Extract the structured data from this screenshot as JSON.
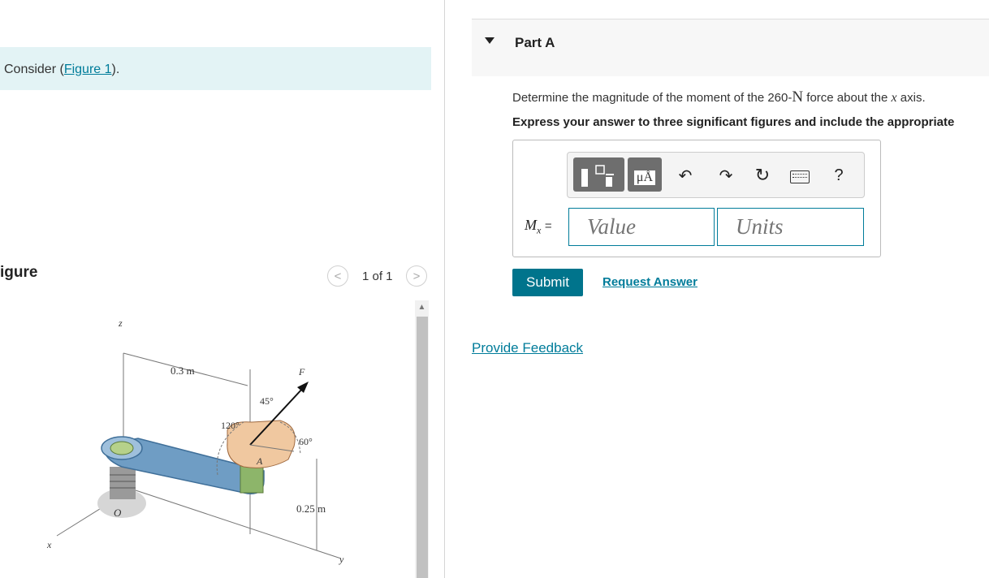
{
  "left_pane": {
    "consider_prefix": "Consider (",
    "figure_link": "Figure 1",
    "consider_suffix": ").",
    "figure_heading": "igure",
    "pager": {
      "prev": "<",
      "count": "1 of 1",
      "next": ">"
    }
  },
  "figure": {
    "z": "z",
    "x": "x",
    "y": "y",
    "O": "O",
    "A": "A",
    "F": "F",
    "dim_03": "0.3 m",
    "dim_025": "0.25 m",
    "angle_45": "45°",
    "angle_120": "120°",
    "angle_60": "60°"
  },
  "part": {
    "title": "Part A",
    "question_prefix": "Determine the magnitude of the moment of the 260-",
    "question_unit": "N",
    "question_mid": " force about the ",
    "question_var": "x",
    "question_suffix": " axis.",
    "instruction": "Express your answer to three significant figures and include the appropriate"
  },
  "toolbar": {
    "template_icon": "template-icon",
    "units_label": "μÅ",
    "undo": "↶",
    "redo": "↷",
    "reset": "↻",
    "keyboard": "keyboard-icon",
    "help": "?"
  },
  "answer": {
    "var": "M",
    "sub": "x",
    "eq": "=",
    "value_placeholder": "Value",
    "units_placeholder": "Units"
  },
  "actions": {
    "submit": "Submit",
    "request_answer": "Request Answer",
    "feedback": "Provide Feedback"
  },
  "colors": {
    "accent": "#007c9a",
    "submit": "#00748c",
    "consider_bg": "#e3f3f5"
  }
}
